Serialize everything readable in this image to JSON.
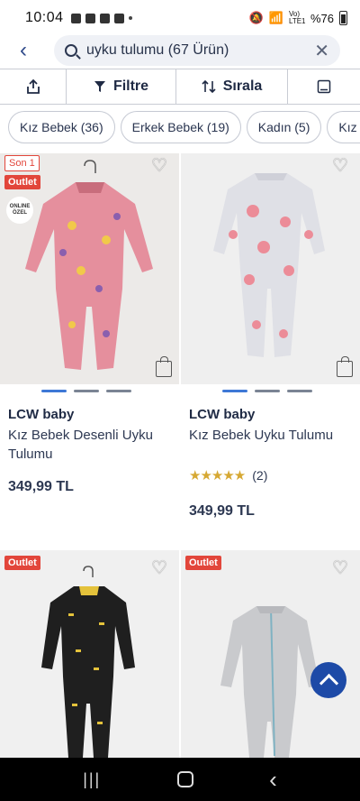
{
  "status_bar": {
    "time": "10:04",
    "battery": "%76",
    "network": "Vo) LTE1"
  },
  "search": {
    "query": "uyku tulumu (67 Ürün)"
  },
  "toolbar": {
    "filter_label": "Filtre",
    "sort_label": "Sırala"
  },
  "chips": [
    "Kız Bebek (36)",
    "Erkek Bebek (19)",
    "Kadın (5)",
    "Kız Ço"
  ],
  "products": [
    {
      "badge_top": "Son 1",
      "badge": "Outlet",
      "online_badge": "ONLINE ÖZEL",
      "brand": "LCW baby",
      "title": "Kız Bebek Desenli Uyku Tulumu",
      "price": "349,99 TL"
    },
    {
      "brand": "LCW baby",
      "title": "Kız Bebek Uyku Tulumu",
      "rating_stars": "★★★★★",
      "rating_count": "(2)",
      "price": "349,99 TL"
    },
    {
      "badge": "Outlet"
    },
    {
      "badge": "Outlet"
    }
  ],
  "colors": {
    "accent": "#1d4aa7",
    "badge": "#e2463b",
    "star": "#d6a833"
  }
}
